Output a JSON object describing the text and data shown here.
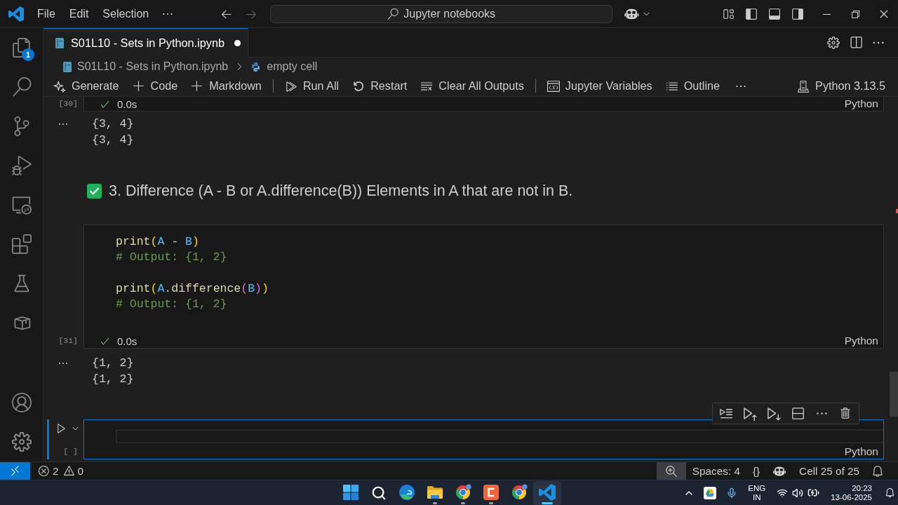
{
  "title_bar": {
    "menus": [
      {
        "label": "File"
      },
      {
        "label": "Edit"
      },
      {
        "label": "Selection"
      }
    ],
    "navigation": [
      {
        "kind": "back",
        "disabled": false
      },
      {
        "kind": "forward",
        "disabled": true
      }
    ],
    "command_center": "Jupyter notebooks"
  },
  "activity_bar": {
    "items": [
      {
        "kind": "explorer",
        "badge": "1"
      },
      {
        "kind": "search"
      },
      {
        "kind": "source-control"
      },
      {
        "kind": "run-debug"
      },
      {
        "kind": "remote-explorer"
      },
      {
        "kind": "extensions"
      },
      {
        "kind": "testing"
      },
      {
        "kind": "containers"
      }
    ],
    "bottom_items": [
      {
        "kind": "account"
      },
      {
        "kind": "settings"
      }
    ]
  },
  "editor_tabs": [
    {
      "label": "S01L10 - Sets in Python.ipynb",
      "selected": true,
      "modified": true
    }
  ],
  "breadcrumbs": [
    {
      "kind": "notebook",
      "label": "S01L10 - Sets in Python.ipynb"
    },
    {
      "kind": "python",
      "label": "empty cell"
    }
  ],
  "notebook_toolbar": {
    "items": [
      {
        "kind": "generate",
        "label": "Generate"
      },
      {
        "kind": "add",
        "label": "Code"
      },
      {
        "kind": "add",
        "label": "Markdown"
      },
      {
        "kind": "separator"
      },
      {
        "kind": "run-all",
        "label": "Run All"
      },
      {
        "kind": "restart",
        "label": "Restart"
      },
      {
        "kind": "clear",
        "label": "Clear All Outputs"
      },
      {
        "kind": "separator"
      },
      {
        "kind": "variables",
        "label": "Jupyter Variables"
      },
      {
        "kind": "outline",
        "label": "Outline"
      },
      {
        "kind": "more"
      }
    ],
    "kernel": "Python 3.13.5"
  },
  "cells": [
    {
      "kind": "code",
      "selected": false,
      "execution_count": "[30]",
      "succeeded": true,
      "duration": "0.0s",
      "language": "Python",
      "outputs": [
        "{3, 4}",
        "{3, 4}"
      ]
    },
    {
      "kind": "markdown",
      "selected": false,
      "text": "3. Difference (A - B or A.difference(B)) Elements in A that are not in B."
    },
    {
      "kind": "code",
      "selected": false,
      "execution_count": "[31]",
      "source": [
        {
          "kind": "code",
          "tokens": [
            {
              "kind": "function",
              "text": "print"
            },
            {
              "kind": "bracket",
              "text": "("
            },
            {
              "kind": "variable",
              "text": "A"
            },
            {
              "kind": "plain",
              "text": " - "
            },
            {
              "kind": "variable",
              "text": "B"
            },
            {
              "kind": "bracket",
              "text": ")"
            }
          ]
        },
        {
          "kind": "code",
          "tokens": [
            {
              "kind": "comment",
              "text": "# Output: {1, 2}"
            }
          ]
        },
        {
          "kind": "blank"
        },
        {
          "kind": "code",
          "tokens": [
            {
              "kind": "function",
              "text": "print"
            },
            {
              "kind": "bracket",
              "text": "("
            },
            {
              "kind": "variable",
              "text": "A"
            },
            {
              "kind": "plain",
              "text": "."
            },
            {
              "kind": "function",
              "text": "difference"
            },
            {
              "kind": "bracket_nested",
              "text": "("
            },
            {
              "kind": "variable",
              "text": "B"
            },
            {
              "kind": "bracket_nested",
              "text": ")"
            },
            {
              "kind": "bracket",
              "text": ")"
            }
          ]
        },
        {
          "kind": "code",
          "tokens": [
            {
              "kind": "comment",
              "text": "# Output: {1, 2}"
            }
          ]
        }
      ],
      "succeeded": true,
      "duration": "0.0s",
      "language": "Python",
      "outputs": [
        "{1, 2}",
        "{1, 2}"
      ]
    },
    {
      "kind": "code",
      "selected": true,
      "execution_count": "[ ]",
      "language": "Python"
    }
  ],
  "status_bar": {
    "errors": "2",
    "warnings": "0",
    "items": [
      {
        "kind": "zoom",
        "highlighted": true
      },
      {
        "kind": "text",
        "label": "Spaces: 4",
        "highlighted": false
      },
      {
        "kind": "text",
        "label": "{}",
        "highlighted": false
      },
      {
        "kind": "copilot",
        "highlighted": false
      },
      {
        "kind": "text",
        "label": "Cell 25 of 25",
        "highlighted": false
      },
      {
        "kind": "notifications",
        "highlighted": false
      }
    ]
  },
  "taskbar": {
    "apps": [
      {
        "kind": "start",
        "running": false,
        "selected": false
      },
      {
        "kind": "search",
        "running": false,
        "selected": false
      },
      {
        "kind": "edge",
        "running": false,
        "selected": false
      },
      {
        "kind": "file-explorer",
        "running": true,
        "selected": false
      },
      {
        "kind": "chrome",
        "running": true,
        "selected": false
      },
      {
        "kind": "app-tile",
        "running": true,
        "selected": false
      },
      {
        "kind": "chrome",
        "running": false,
        "selected": false
      },
      {
        "kind": "vscode",
        "running": true,
        "selected": true
      }
    ],
    "tray": {
      "language": [
        "ENG",
        "IN"
      ],
      "time": "20:23",
      "date": "13-06-2025"
    }
  }
}
